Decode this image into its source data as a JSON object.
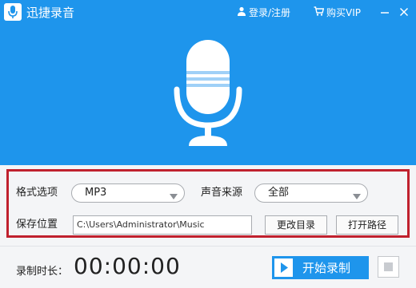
{
  "app": {
    "title": "迅捷录音",
    "accent": "#1e95ec",
    "highlight_border": "#c0212e"
  },
  "titlebar": {
    "login": {
      "icon": "user-icon",
      "label": "登录/注册"
    },
    "buy": {
      "icon": "cart-icon",
      "label": "购买VIP"
    },
    "minimize_icon": "minimize-icon",
    "close_icon": "close-icon"
  },
  "hero": {
    "icon": "microphone-icon"
  },
  "settings": {
    "format": {
      "label": "格式选项",
      "value": "MP3"
    },
    "source": {
      "label": "声音来源",
      "value": "全部"
    },
    "save": {
      "label": "保存位置",
      "path": "C:\\Users\\Administrator\\Music",
      "change_dir_label": "更改目录",
      "open_path_label": "打开路径"
    }
  },
  "footer": {
    "duration_label": "录制时长：",
    "duration_value": "00:00:00",
    "start_label": "开始录制",
    "start_icon": "play-icon",
    "stop_icon": "stop-icon"
  }
}
